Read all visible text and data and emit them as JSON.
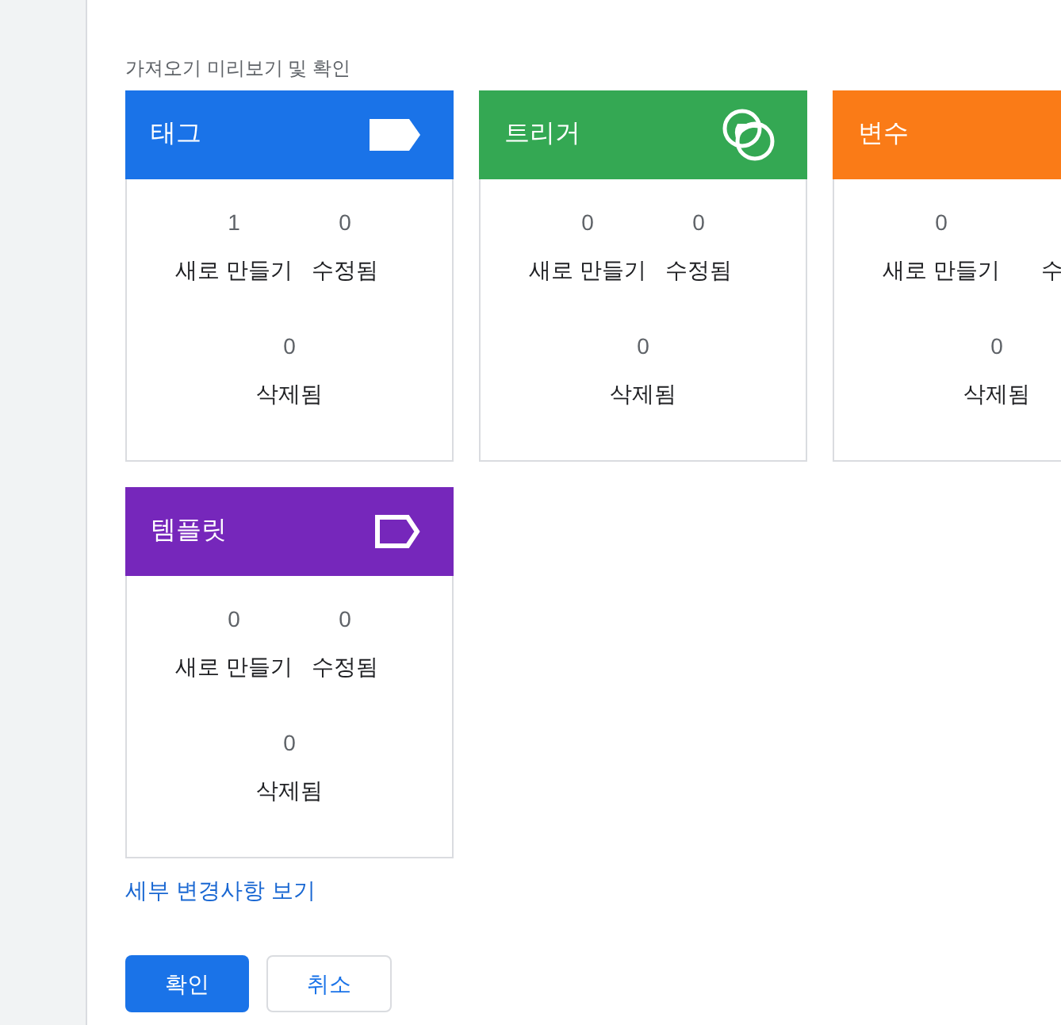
{
  "section_title": "가져오기 미리보기 및 확인",
  "cards": [
    {
      "title": "태그",
      "kind": "tag",
      "color": "#1a73e8",
      "new": {
        "count": "1",
        "label": "새로 만들기"
      },
      "modified": {
        "count": "0",
        "label": "수정됨"
      },
      "deleted": {
        "count": "0",
        "label": "삭제됨"
      }
    },
    {
      "title": "트리거",
      "kind": "trigger",
      "color": "#34a853",
      "new": {
        "count": "0",
        "label": "새로 만들기"
      },
      "modified": {
        "count": "0",
        "label": "수정됨"
      },
      "deleted": {
        "count": "0",
        "label": "삭제됨"
      }
    },
    {
      "title": "변수",
      "kind": "variable",
      "color": "#fa7b17",
      "new": {
        "count": "0",
        "label": "새로 만들기"
      },
      "modified": {
        "label": "수"
      },
      "deleted": {
        "count": "0",
        "label": "삭제됨"
      }
    },
    {
      "title": "템플릿",
      "kind": "template",
      "color": "#7627bb",
      "new": {
        "count": "0",
        "label": "새로 만들기"
      },
      "modified": {
        "count": "0",
        "label": "수정됨"
      },
      "deleted": {
        "count": "0",
        "label": "삭제됨"
      }
    }
  ],
  "details_link": "세부 변경사항 보기",
  "buttons": {
    "confirm": "확인",
    "cancel": "취소"
  }
}
